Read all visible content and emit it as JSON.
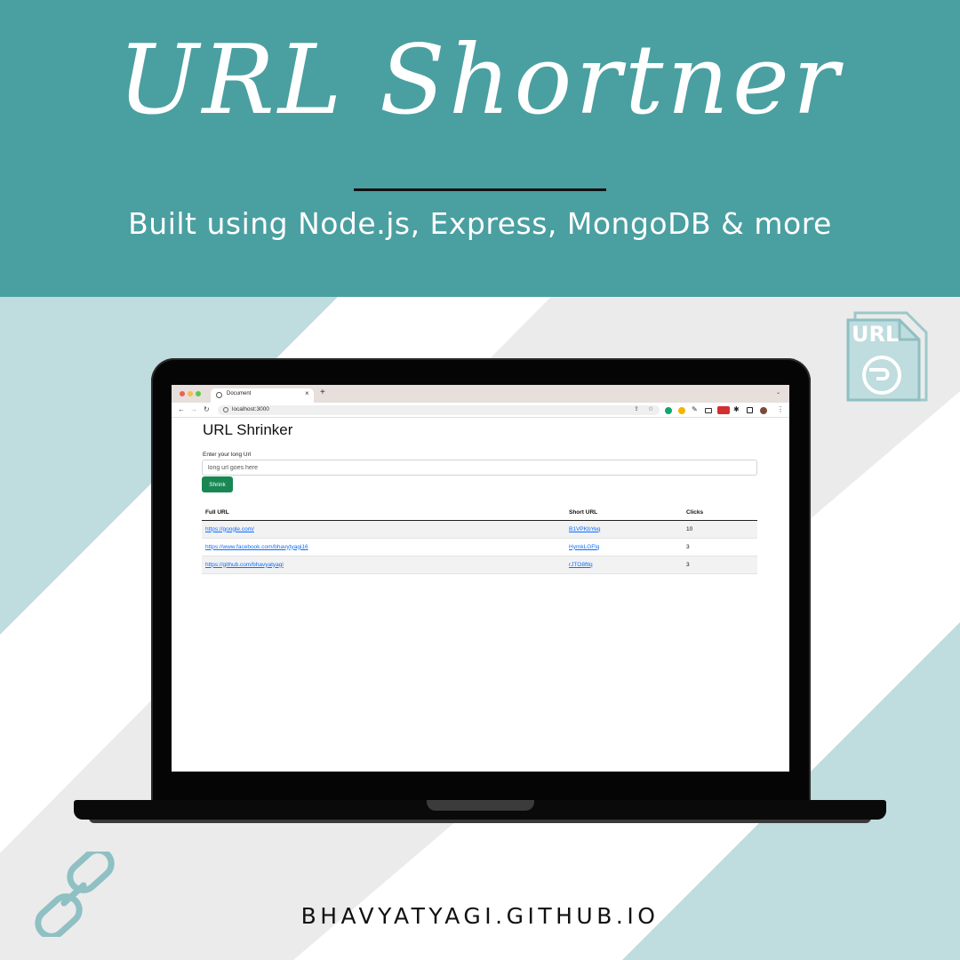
{
  "poster": {
    "title": "URL Shortner",
    "subtitle": "Built using Node.js, Express, MongoDB & more",
    "footer": "BHAVYATYAGI.GITHUB.IO",
    "url_icon_text": "URL",
    "colors": {
      "header_teal": "#4a9fa1",
      "stripe_light": "#bfdcde",
      "stripe_white": "#ffffff",
      "stripe_grey": "#ebebeb"
    }
  },
  "browser": {
    "tab_title": "Document",
    "tab_close": "×",
    "new_tab": "+",
    "address": "localhost:3000",
    "icons": [
      "back-icon",
      "forward-icon",
      "reload-icon",
      "info-icon",
      "share-icon",
      "star-icon",
      "grammarly-icon",
      "extension-icon",
      "pen-icon",
      "picture-in-picture-icon",
      "youtube-icon",
      "puzzle-icon",
      "sidebar-icon",
      "profile-avatar",
      "more-menu-icon"
    ]
  },
  "app": {
    "heading": "URL Shrinker",
    "input_label": "Enter your long Url",
    "input_placeholder": "long url goes here",
    "button_label": "Shrink",
    "button_color": "#198754",
    "table": {
      "headers": {
        "full": "Full URL",
        "short": "Short URL",
        "clicks": "Clicks"
      },
      "rows": [
        {
          "full": "https://google.com/",
          "short": "B1VPKbYeq",
          "clicks": "10"
        },
        {
          "full": "https://www.facebook.com/bhavytyagi16",
          "short": "HymkLGFlq",
          "clicks": "3"
        },
        {
          "full": "https://github.com/bhavyatyagi",
          "short": "rJTO8ftlq",
          "clicks": "3"
        }
      ]
    }
  }
}
